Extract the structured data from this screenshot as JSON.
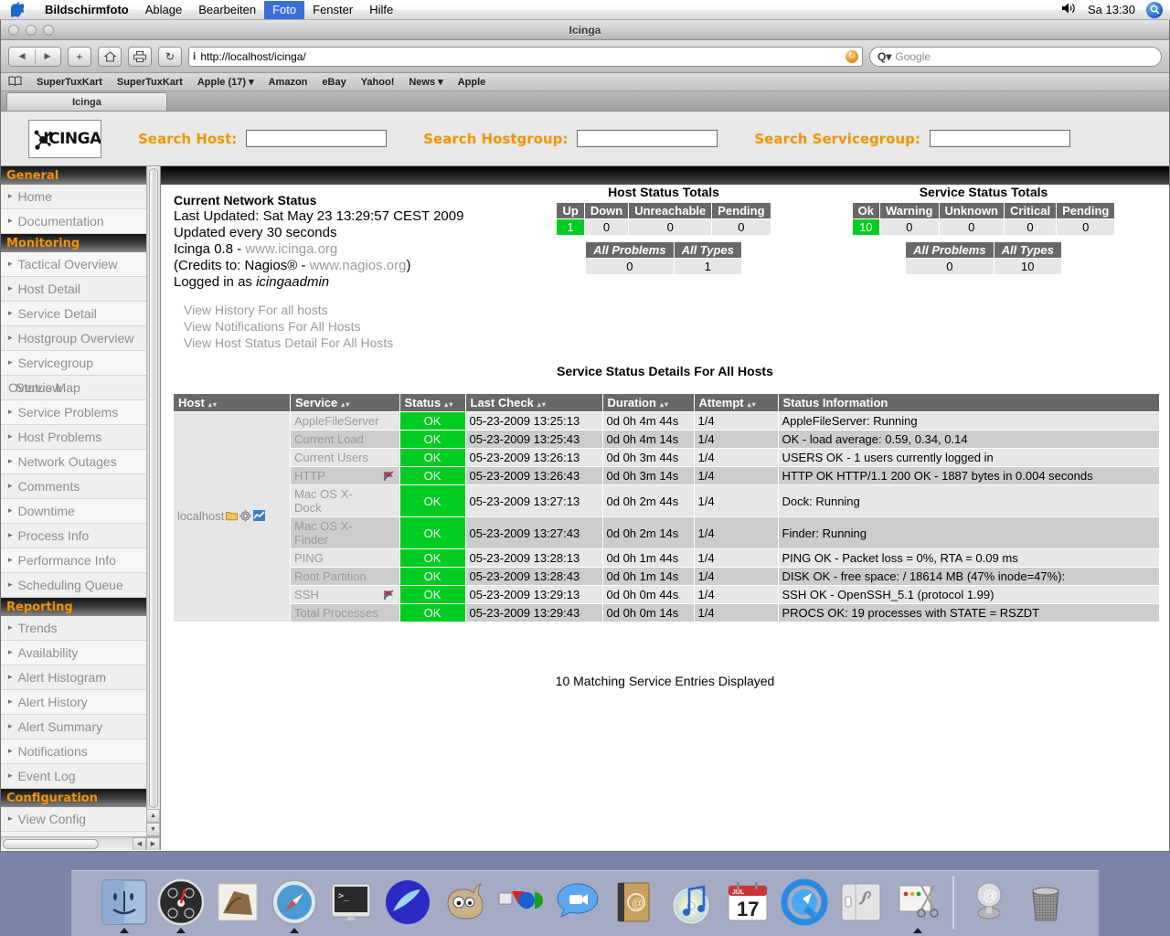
{
  "menubar": {
    "apple_icon": "apple-icon",
    "items": [
      {
        "label": "Bildschirmfoto",
        "bold": true,
        "active": false
      },
      {
        "label": "Ablage",
        "bold": false,
        "active": false
      },
      {
        "label": "Bearbeiten",
        "bold": false,
        "active": false
      },
      {
        "label": "Foto",
        "bold": false,
        "active": true
      },
      {
        "label": "Fenster",
        "bold": false,
        "active": false
      },
      {
        "label": "Hilfe",
        "bold": false,
        "active": false
      }
    ],
    "volume_icon": "speaker-icon",
    "clock": "Sa 13:30",
    "spotlight_icon": "spotlight-search-icon"
  },
  "browser": {
    "window_title": "Icinga",
    "back_icon": "back-arrow-icon",
    "forward_icon": "forward-arrow-icon",
    "add_label": "+",
    "home_icon": "home-icon",
    "print_icon": "printer-icon",
    "reload_label": "↻",
    "url": "http://localhost/icinga/",
    "url_info_icon": "info-icon",
    "url_reload_icon": "reload-circle-icon",
    "search_placeholder": "Google",
    "search_icon": "magnifier-icon",
    "bookmarks": [
      "SuperTuxKart",
      "SuperTuxKart",
      "Apple (17) ▾",
      "Amazon",
      "eBay",
      "Yahoo!",
      "News ▾",
      "Apple"
    ],
    "bookmarks_icon": "book-icon",
    "tabs": [
      {
        "label": "Icinga",
        "active": true
      }
    ]
  },
  "icinga_header": {
    "logo_text": "ICINGA",
    "logo_icon": "icinga-atom-icon",
    "search_host_label": "Search Host:",
    "search_host_value": "",
    "search_hostgroup_label": "Search Hostgroup:",
    "search_hostgroup_value": "",
    "search_servicegroup_label": "Search Servicegroup:",
    "search_servicegroup_value": ""
  },
  "sidebar": {
    "sections": [
      {
        "title": "General",
        "items": [
          {
            "label": "Home"
          },
          {
            "label": "Documentation"
          }
        ]
      },
      {
        "title": "Monitoring",
        "items": [
          {
            "label": "Tactical Overview"
          },
          {
            "label": "Host Detail"
          },
          {
            "label": "Service Detail"
          },
          {
            "label": "Hostgroup Overview"
          },
          {
            "label": "Servicegroup"
          },
          {
            "label": "Overview",
            "label2": "Status Map",
            "overlap": true
          },
          {
            "label": "Service Problems"
          },
          {
            "label": "Host Problems"
          },
          {
            "label": "Network Outages"
          },
          {
            "label": "Comments"
          },
          {
            "label": "Downtime"
          },
          {
            "label": "Process Info"
          },
          {
            "label": "Performance Info"
          },
          {
            "label": "Scheduling Queue"
          }
        ]
      },
      {
        "title": "Reporting",
        "items": [
          {
            "label": "Trends"
          },
          {
            "label": "Availability"
          },
          {
            "label": "Alert Histogram"
          },
          {
            "label": "Alert History"
          },
          {
            "label": "Alert Summary"
          },
          {
            "label": "Notifications"
          },
          {
            "label": "Event Log"
          }
        ]
      },
      {
        "title": "Configuration",
        "items": [
          {
            "label": "View Config"
          }
        ]
      }
    ]
  },
  "status_panel": {
    "heading": "Current Network Status",
    "last_updated": "Last Updated: Sat May 23 13:29:57 CEST 2009",
    "update_interval": "Updated every 30 seconds",
    "version_prefix": "Icinga 0.8 - ",
    "version_link": "www.icinga.org",
    "credits_prefix": "(Credits to: Nagios® - ",
    "credits_link": "www.nagios.org",
    "credits_suffix": ")",
    "logged_in_prefix": "Logged in as ",
    "logged_in_user": "icingaadmin",
    "links": [
      "View History For all hosts",
      "View Notifications For All Hosts",
      "View Host Status Detail For All Hosts"
    ]
  },
  "host_totals": {
    "title": "Host Status Totals",
    "headers": [
      "Up",
      "Down",
      "Unreachable",
      "Pending"
    ],
    "values": [
      "1",
      "0",
      "0",
      "0"
    ],
    "summary_headers": [
      "All Problems",
      "All Types"
    ],
    "summary_values": [
      "0",
      "1"
    ]
  },
  "service_totals": {
    "title": "Service Status Totals",
    "headers": [
      "Ok",
      "Warning",
      "Unknown",
      "Critical",
      "Pending"
    ],
    "values": [
      "10",
      "0",
      "0",
      "0",
      "0"
    ],
    "summary_headers": [
      "All Problems",
      "All Types"
    ],
    "summary_values": [
      "0",
      "10"
    ]
  },
  "service_table": {
    "title": "Service Status Details For All Hosts",
    "columns": [
      {
        "label": "Host",
        "sortable": true
      },
      {
        "label": "Service",
        "sortable": true
      },
      {
        "label": "Status",
        "sortable": true
      },
      {
        "label": "Last Check",
        "sortable": true
      },
      {
        "label": "Duration",
        "sortable": true
      },
      {
        "label": "Attempt",
        "sortable": true
      },
      {
        "label": "Status Information",
        "sortable": false
      }
    ],
    "host_name": "localhost",
    "host_icons": [
      "folder-icon",
      "gear-icon",
      "trends-icon"
    ],
    "rows": [
      {
        "service": "AppleFileServer",
        "flag": false,
        "status": "OK",
        "last_check": "05-23-2009 13:25:13",
        "duration": "0d 0h 4m 44s",
        "attempt": "1/4",
        "info": "AppleFileServer: Running"
      },
      {
        "service": "Current Load",
        "flag": false,
        "status": "OK",
        "last_check": "05-23-2009 13:25:43",
        "duration": "0d 0h 4m 14s",
        "attempt": "1/4",
        "info": "OK - load average: 0.59, 0.34, 0.14"
      },
      {
        "service": "Current Users",
        "flag": false,
        "status": "OK",
        "last_check": "05-23-2009 13:26:13",
        "duration": "0d 0h 3m 44s",
        "attempt": "1/4",
        "info": "USERS OK - 1 users currently logged in"
      },
      {
        "service": "HTTP",
        "flag": true,
        "status": "OK",
        "last_check": "05-23-2009 13:26:43",
        "duration": "0d 0h 3m 14s",
        "attempt": "1/4",
        "info": "HTTP OK HTTP/1.1 200 OK - 1887 bytes in 0.004 seconds"
      },
      {
        "service": "Mac OS X-Dock",
        "flag": false,
        "status": "OK",
        "last_check": "05-23-2009 13:27:13",
        "duration": "0d 0h 2m 44s",
        "attempt": "1/4",
        "info": "Dock: Running"
      },
      {
        "service": "Mac OS X-Finder",
        "flag": false,
        "status": "OK",
        "last_check": "05-23-2009 13:27:43",
        "duration": "0d 0h 2m 14s",
        "attempt": "1/4",
        "info": "Finder: Running"
      },
      {
        "service": "PING",
        "flag": false,
        "status": "OK",
        "last_check": "05-23-2009 13:28:13",
        "duration": "0d 0h 1m 44s",
        "attempt": "1/4",
        "info": "PING OK - Packet loss = 0%, RTA = 0.09 ms"
      },
      {
        "service": "Root Partition",
        "flag": false,
        "status": "OK",
        "last_check": "05-23-2009 13:28:43",
        "duration": "0d 0h 1m 14s",
        "attempt": "1/4",
        "info": "DISK OK - free space: / 18614 MB (47% inode=47%):"
      },
      {
        "service": "SSH",
        "flag": true,
        "status": "OK",
        "last_check": "05-23-2009 13:29:13",
        "duration": "0d 0h 0m 44s",
        "attempt": "1/4",
        "info": "SSH OK - OpenSSH_5.1 (protocol 1.99)"
      },
      {
        "service": "Total Processes",
        "flag": false,
        "status": "OK",
        "last_check": "05-23-2009 13:29:43",
        "duration": "0d 0h 0m 14s",
        "attempt": "1/4",
        "info": "PROCS OK: 19 processes with STATE = RSZDT"
      }
    ],
    "footer": "10 Matching Service Entries Displayed"
  },
  "dock": {
    "items": [
      {
        "name": "finder-icon",
        "running": true
      },
      {
        "name": "dashboard-icon",
        "running": true
      },
      {
        "name": "mail-icon",
        "running": false
      },
      {
        "name": "safari-icon",
        "running": true
      },
      {
        "name": "terminal-icon",
        "running": false
      },
      {
        "name": "camino-icon",
        "running": false
      },
      {
        "name": "gimp-icon",
        "running": false
      },
      {
        "name": "vlc-colors-icon",
        "running": false
      },
      {
        "name": "ichat-icon",
        "running": false
      },
      {
        "name": "address-book-icon",
        "running": false
      },
      {
        "name": "itunes-icon",
        "running": false
      },
      {
        "name": "ical-icon",
        "running": false
      },
      {
        "name": "quicktime-icon",
        "running": false
      },
      {
        "name": "system-preferences-icon",
        "running": false
      },
      {
        "name": "grab-icon",
        "running": true
      }
    ],
    "right_items": [
      {
        "name": "mail-stamp-icon"
      },
      {
        "name": "trash-icon"
      }
    ],
    "ical_month": "JUL",
    "ical_day": "17"
  },
  "colors": {
    "accent_orange": "#f29400",
    "ok_green": "#00cc22",
    "header_gray": "#686868",
    "row_light": "#e6e6e6",
    "row_dark": "#cccccc"
  }
}
